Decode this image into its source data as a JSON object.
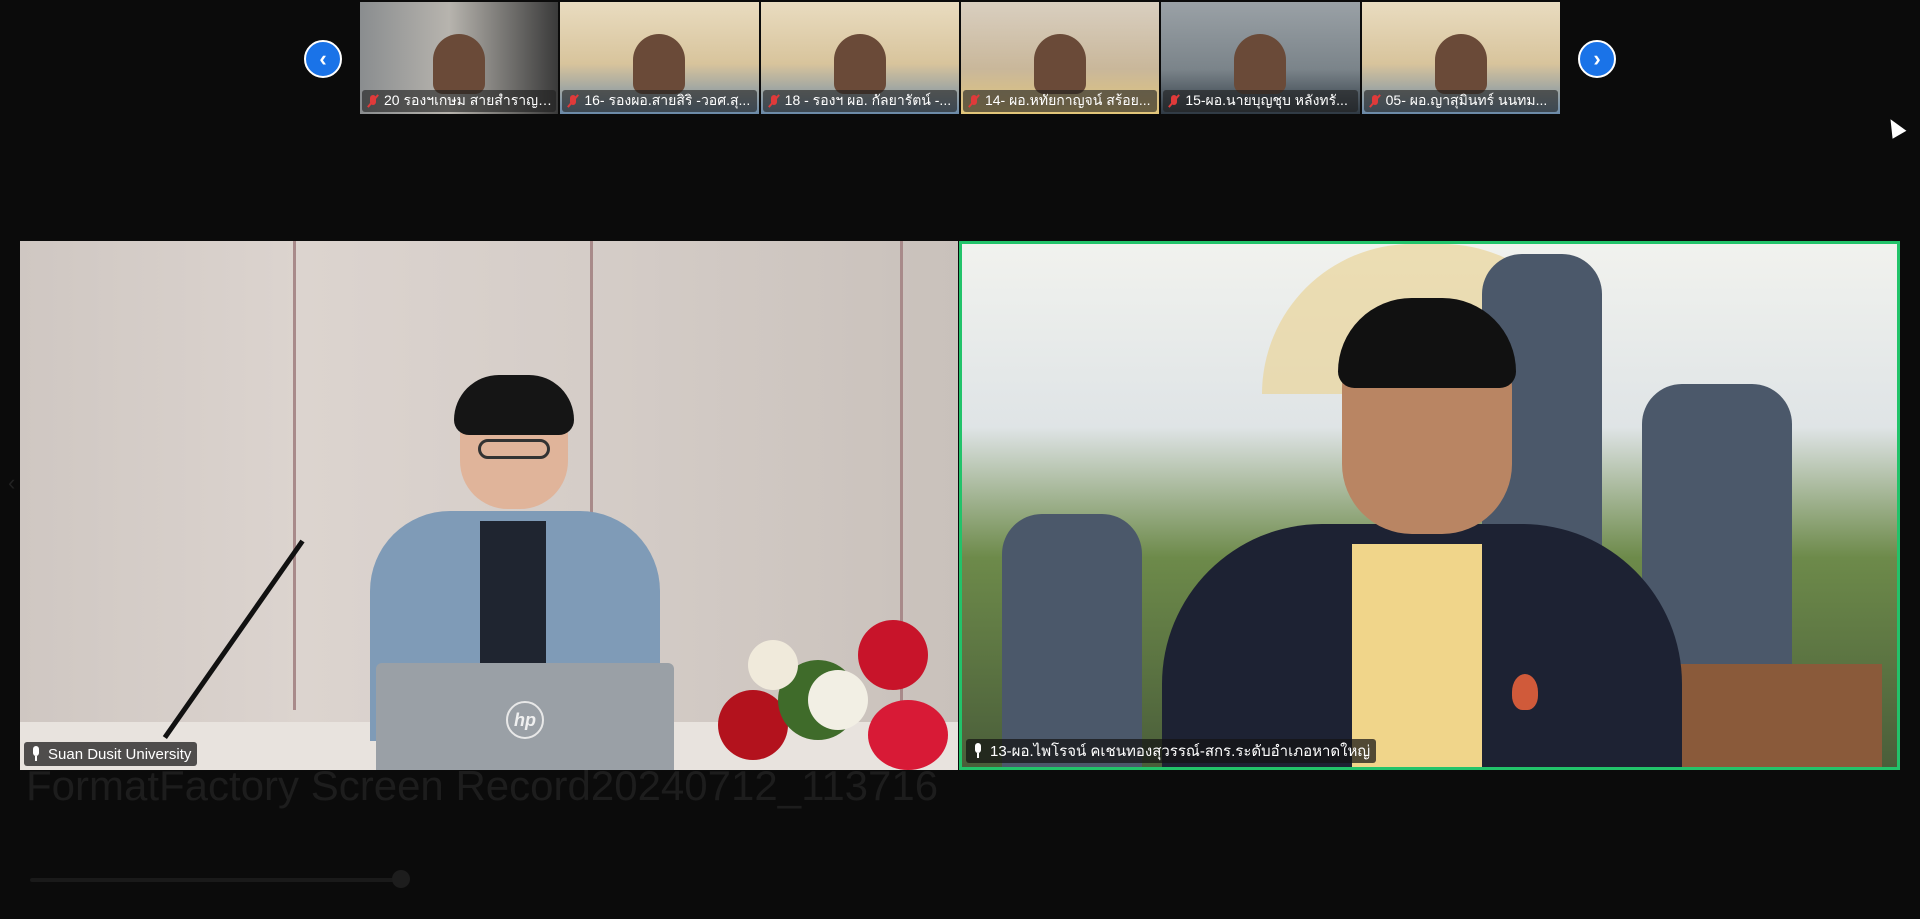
{
  "filmstrip": {
    "participants": [
      {
        "label": "20 รองฯเกษม สายสำราญ ..."
      },
      {
        "label": "16- รองผอ.สายสิริ -วอศ.สุ..."
      },
      {
        "label": "18 - รองฯ ผอ. กัลยารัตน์ -..."
      },
      {
        "label": "14- ผอ.หทัยกาญจน์ สร้อย..."
      },
      {
        "label": "15-ผอ.นายบุญชุบ หลังทรั..."
      },
      {
        "label": "05- ผอ.ญาสุมินทร์ นนทม..."
      }
    ],
    "prev_label": "‹",
    "next_label": "›"
  },
  "main": {
    "left": {
      "label": "Suan Dusit University"
    },
    "right": {
      "label": "13-ผอ.ไพโรจน์ คเชนทองสุวรรณ์-สกร.ระดับอำเภอหาดใหญ่"
    }
  },
  "laptop_brand": "hp",
  "background": {
    "title": "FormatFactory Screen Record20240712_113716"
  },
  "colors": {
    "active_speaker_border": "#22c36a",
    "nav_button": "#1a73e8",
    "muted": "#e03a3a"
  }
}
